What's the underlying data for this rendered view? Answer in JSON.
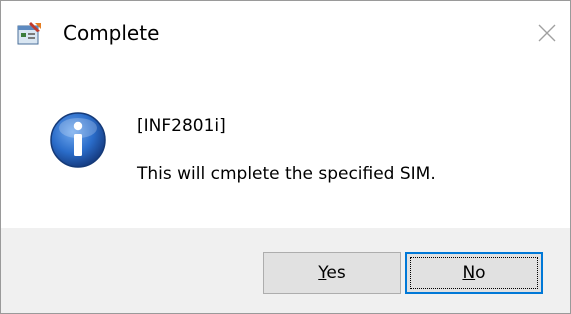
{
  "window": {
    "title": "Complete",
    "icon": "app-icon",
    "close_icon": "close-icon"
  },
  "message": {
    "icon": "info-icon",
    "code": "[INF2801i]",
    "text": "This will cmplete the specified SIM."
  },
  "buttons": {
    "yes": {
      "mnemonic": "Y",
      "rest": "es"
    },
    "no": {
      "mnemonic": "N",
      "rest": "o"
    }
  },
  "colors": {
    "info_blue": "#1f5fb8",
    "focus_border": "#0078d7",
    "footer_bg": "#f0f0f0"
  }
}
